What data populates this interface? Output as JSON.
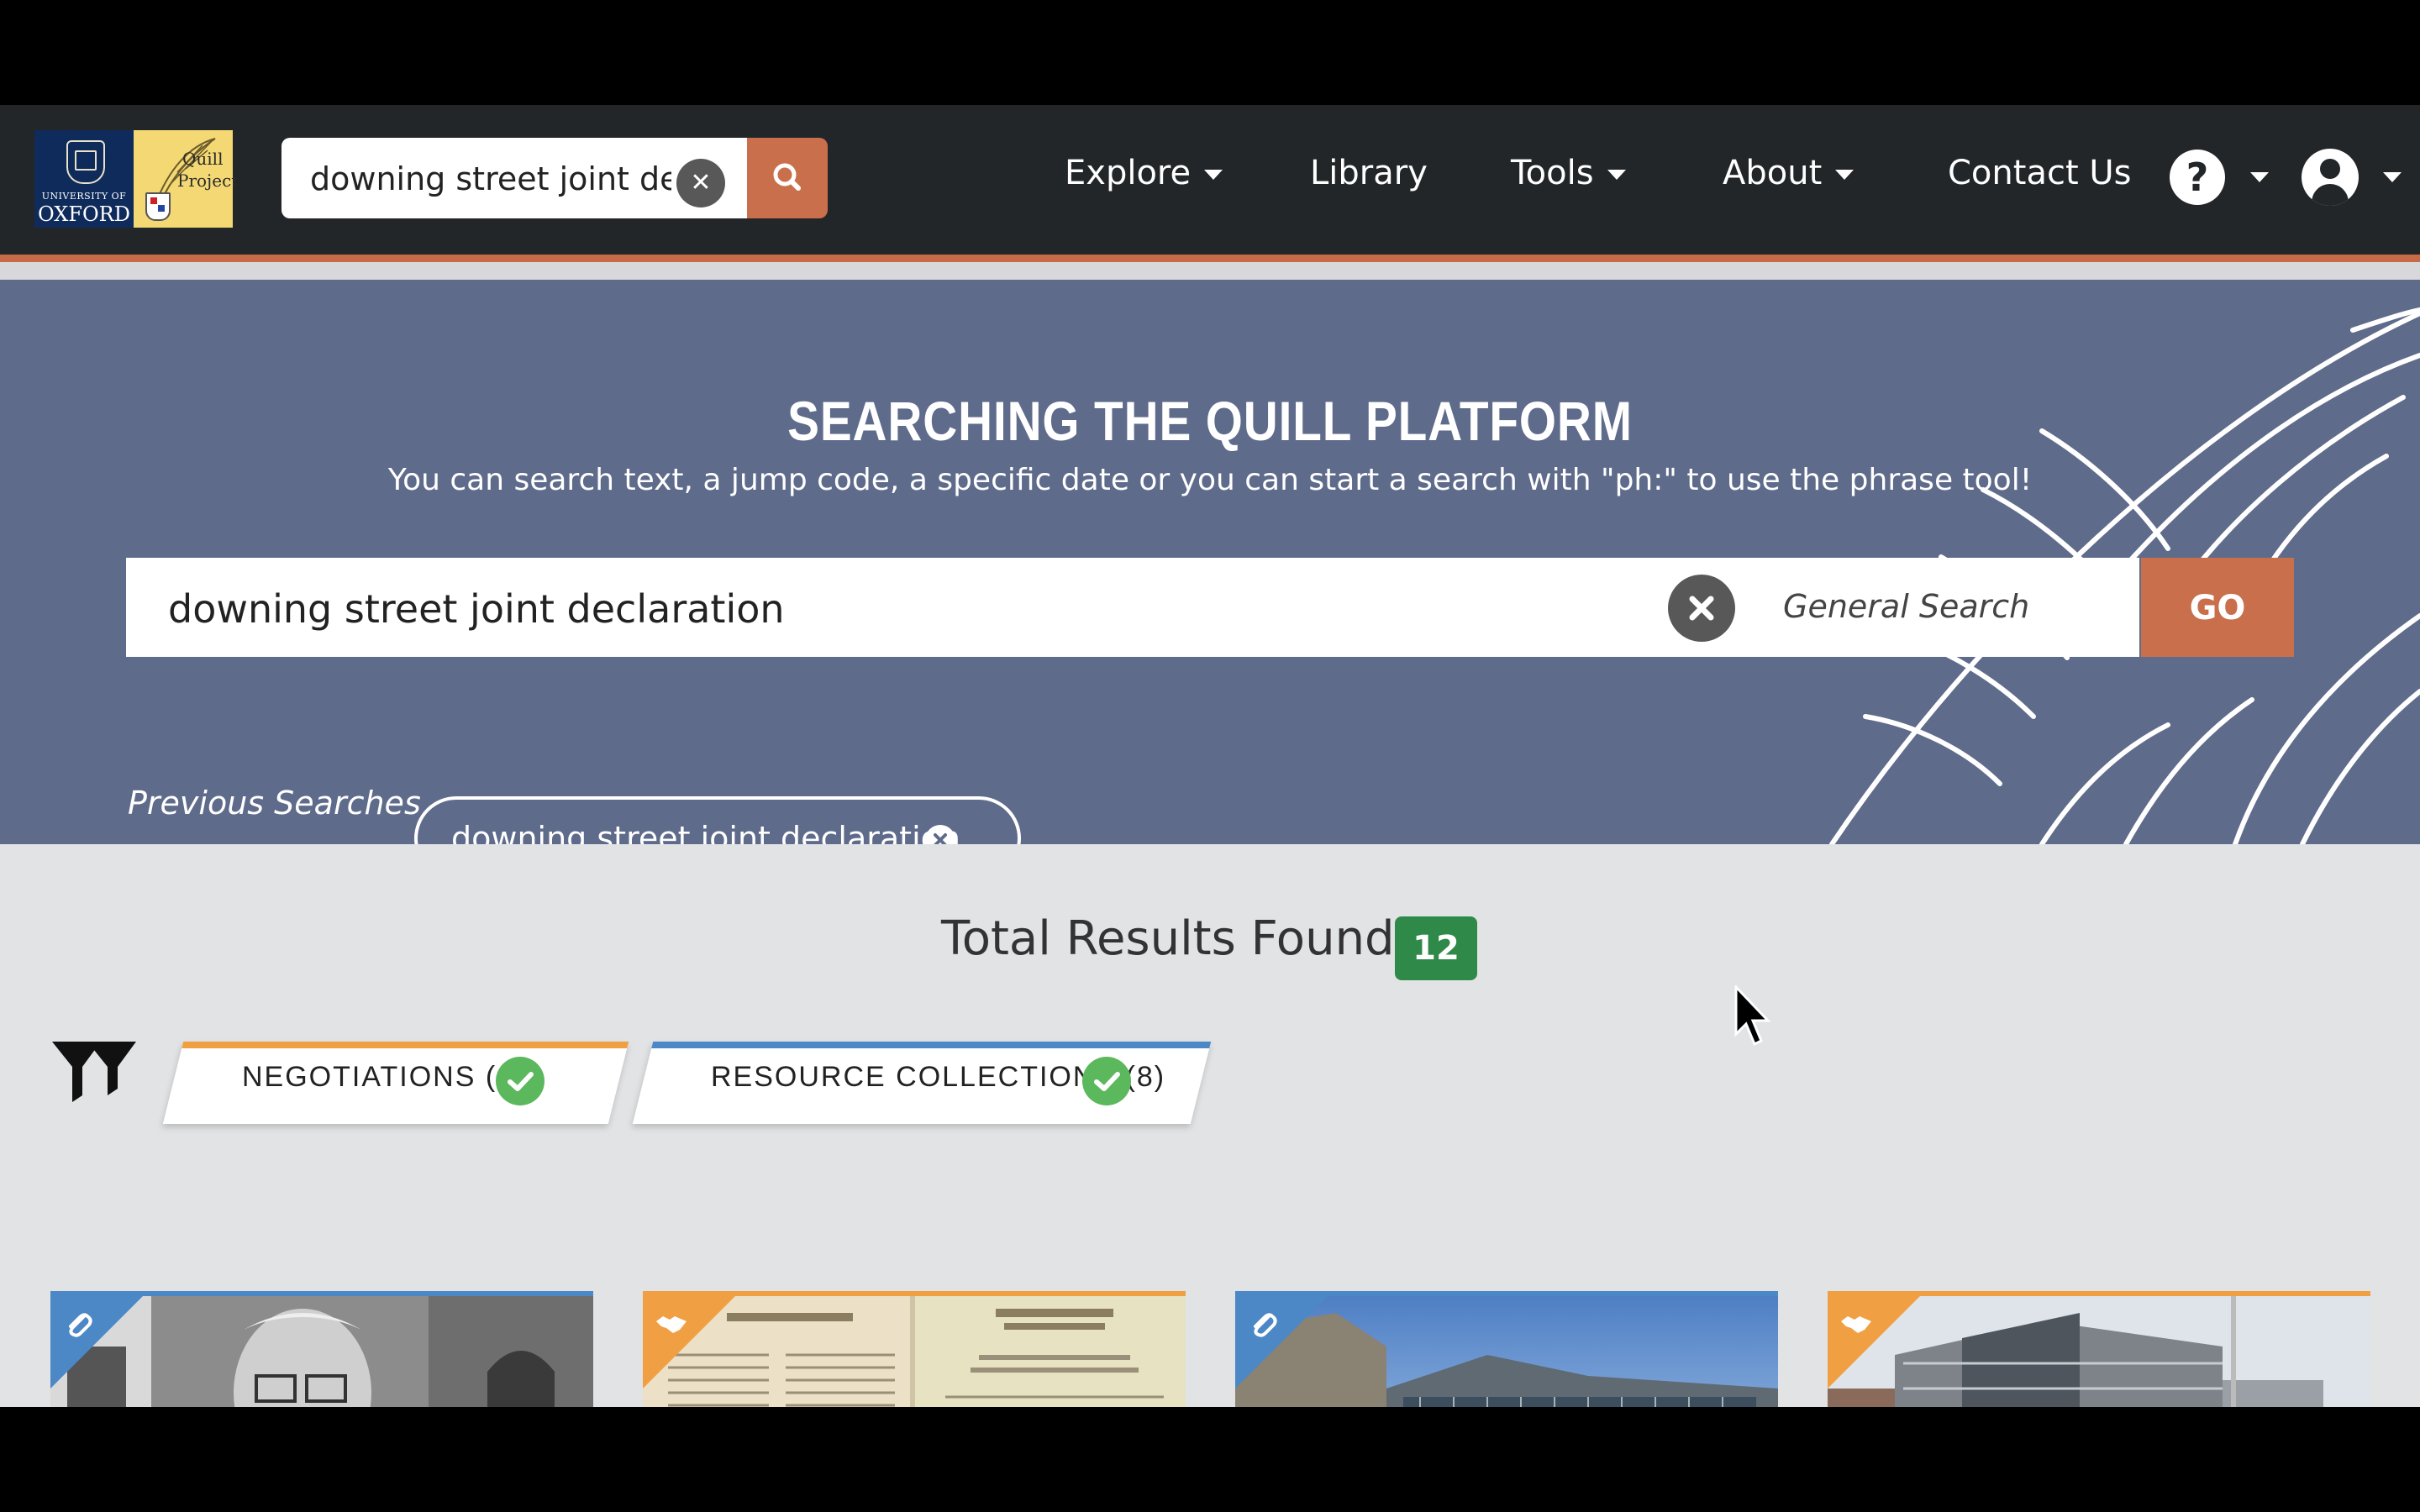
{
  "navbar": {
    "logo_oxford": {
      "line1": "UNIVERSITY OF",
      "line2": "OXFORD"
    },
    "logo_quill": {
      "line1": "Quill",
      "line2": "Project"
    },
    "search": {
      "value": "downing street joint de"
    },
    "menu": [
      {
        "label": "Explore",
        "has_dropdown": true
      },
      {
        "label": "Library",
        "has_dropdown": false
      },
      {
        "label": "Tools",
        "has_dropdown": true
      },
      {
        "label": "About",
        "has_dropdown": true
      },
      {
        "label": "Contact Us",
        "has_dropdown": false
      }
    ],
    "help_icon": "question-circle-icon",
    "user_icon": "user-circle-icon"
  },
  "hero": {
    "title": "SEARCHING THE QUILL PLATFORM",
    "subtitle": "You can search text, a jump code, a specific date or you can start a search with \"ph:\" to use the phrase tool!",
    "search_value": "downing street joint declaration",
    "search_type": "General Search",
    "go_label": "GO",
    "previous_label": "Previous Searches",
    "previous_searches": [
      "downing street joint declaration"
    ]
  },
  "results": {
    "title": "Total Results Found",
    "count": "12",
    "tabs": [
      {
        "label": "NEGOTIATIONS (4)",
        "accent": "#f0a043",
        "checked": true
      },
      {
        "label": "RESOURCE COLLECTIONS (8)",
        "accent": "#4b88c5",
        "checked": true
      }
    ],
    "cards": [
      {
        "kind": "resource",
        "icon": "paperclip-icon",
        "corner_color": "#4b88c5",
        "image": "portrait-photo"
      },
      {
        "kind": "negotiation",
        "icon": "handshake-icon",
        "corner_color": "#f0a043",
        "image": "joint-declaration-document"
      },
      {
        "kind": "resource",
        "icon": "paperclip-icon",
        "corner_color": "#4b88c5",
        "image": "building-plaza-photo"
      },
      {
        "kind": "negotiation",
        "icon": "handshake-icon",
        "corner_color": "#f0a043",
        "image": "office-building-photo"
      }
    ]
  },
  "colors": {
    "navbar": "#222629",
    "accent": "#c96f4c",
    "hero": "#5f6b8b",
    "badge": "#2f8a4a",
    "check": "#5cb85c"
  }
}
